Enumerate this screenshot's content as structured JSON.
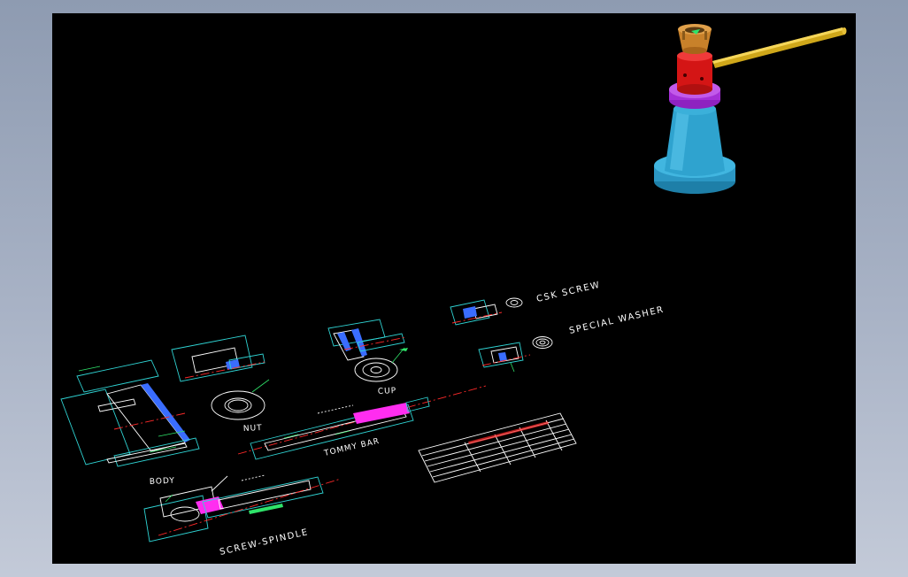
{
  "window": {
    "background": "#000000",
    "frame_color": "#a9b3c6"
  },
  "model_3d": {
    "name": "screw-jack-assembly",
    "colors": {
      "cup": "#c8812a",
      "nut": "#e01a1a",
      "washer": "#b03ae0",
      "body": "#2fa3cf",
      "tommy_bar": "#d9b321"
    }
  },
  "labels": {
    "csk_screw": "CSK SCREW",
    "special_washer": "SPECIAL WASHER",
    "cup": "CUP",
    "nut": "NUT",
    "tommy_bar": "TOMMY BAR",
    "body": "BODY",
    "screw_spindle": "SCREW-SPINDLE"
  },
  "colors": {
    "outline": "#2fd3d3",
    "center_line": "#ff2a2a",
    "dimension": "#2fe36a",
    "section_fill": "#3a6dff",
    "highlight": "#ff2df0"
  }
}
